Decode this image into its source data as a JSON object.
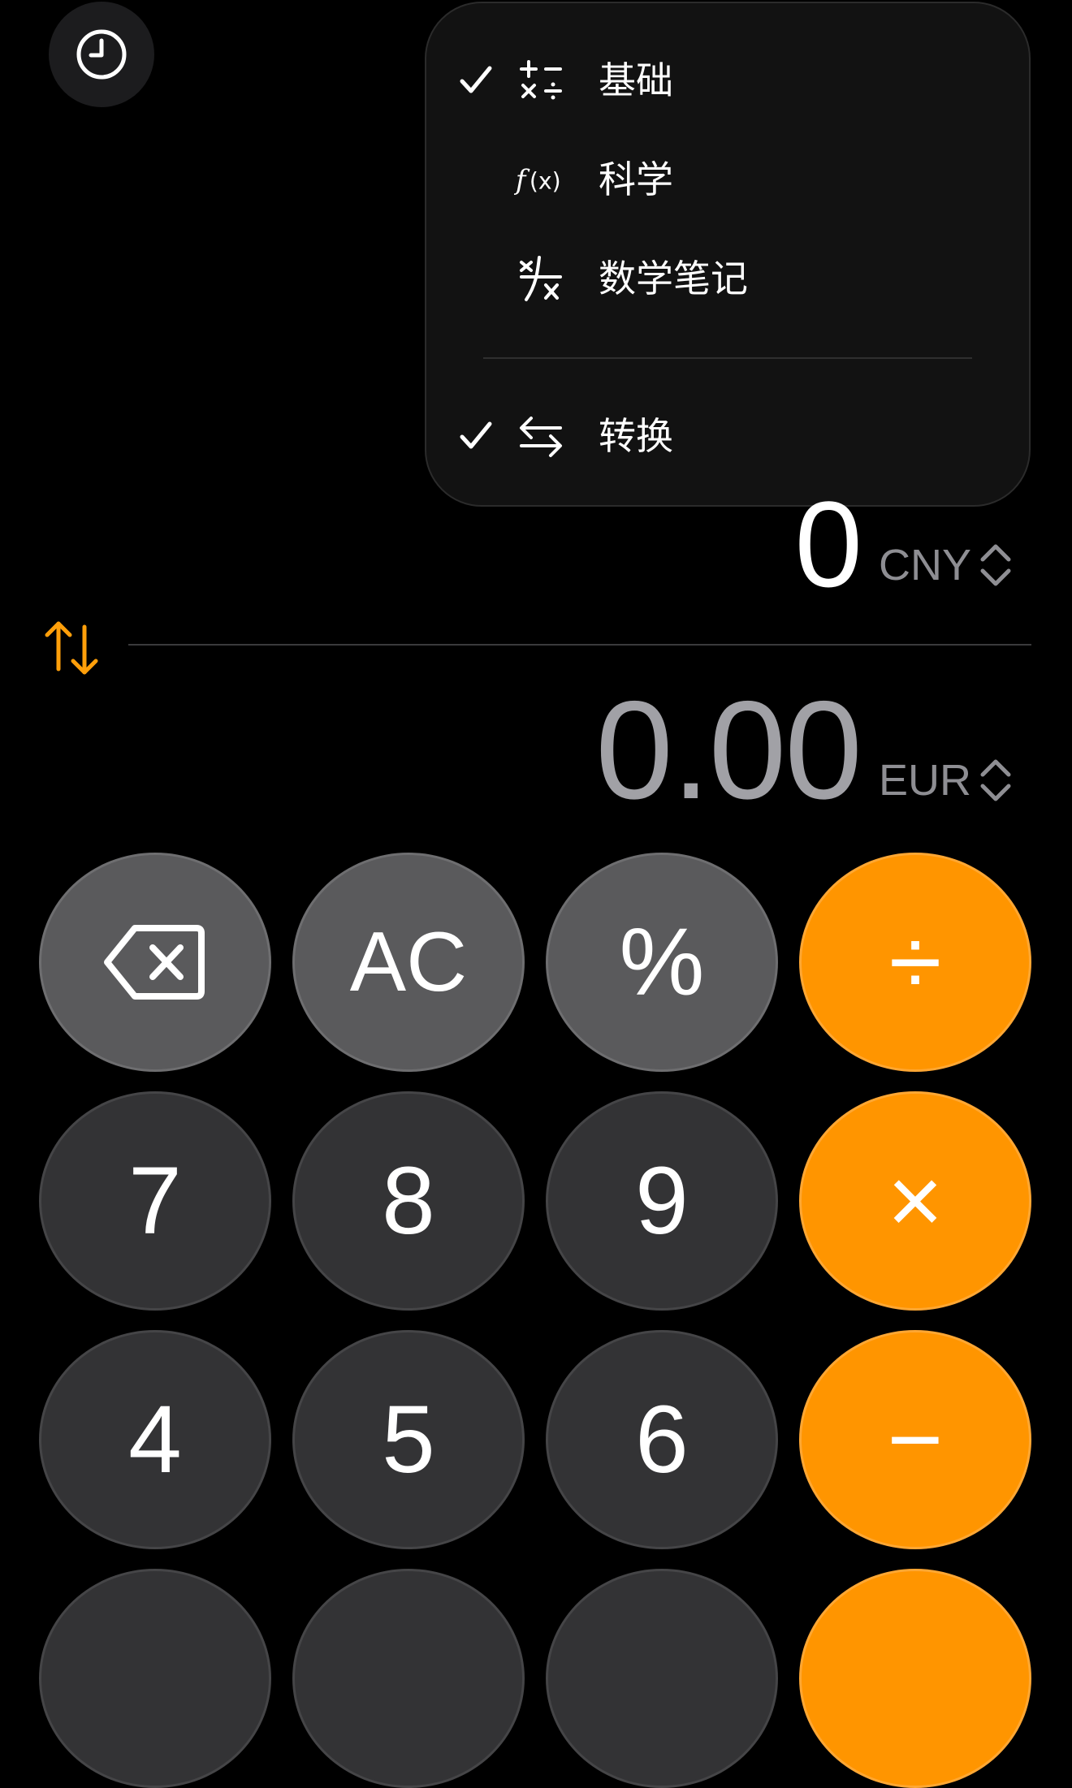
{
  "history": {
    "icon": "clock-icon"
  },
  "menu": {
    "items": [
      {
        "label": "基础",
        "icon": "basic-operators-icon",
        "checked": true
      },
      {
        "label": "科学",
        "icon": "function-fx-icon",
        "checked": false
      },
      {
        "label": "数学笔记",
        "icon": "math-notes-icon",
        "checked": false
      },
      {
        "label": "转换",
        "icon": "convert-arrows-icon",
        "checked": true
      }
    ]
  },
  "converter": {
    "top": {
      "value": "0",
      "unit": "CNY"
    },
    "bottom": {
      "value": "0.00",
      "unit": "EUR"
    },
    "swap_icon": "swap-arrows-icon",
    "accent": "#ff9f0a"
  },
  "keypad": {
    "backspace_icon": "backspace-icon",
    "ac": "AC",
    "percent": "%",
    "divide": "÷",
    "multiply": "×",
    "minus": "−",
    "seven": "7",
    "eight": "8",
    "nine": "9",
    "four": "4",
    "five": "5",
    "six": "6"
  },
  "colors": {
    "background": "#000000",
    "key_gray": "#5a5a5c",
    "key_dark": "#333335",
    "key_orange": "#ff9500"
  }
}
